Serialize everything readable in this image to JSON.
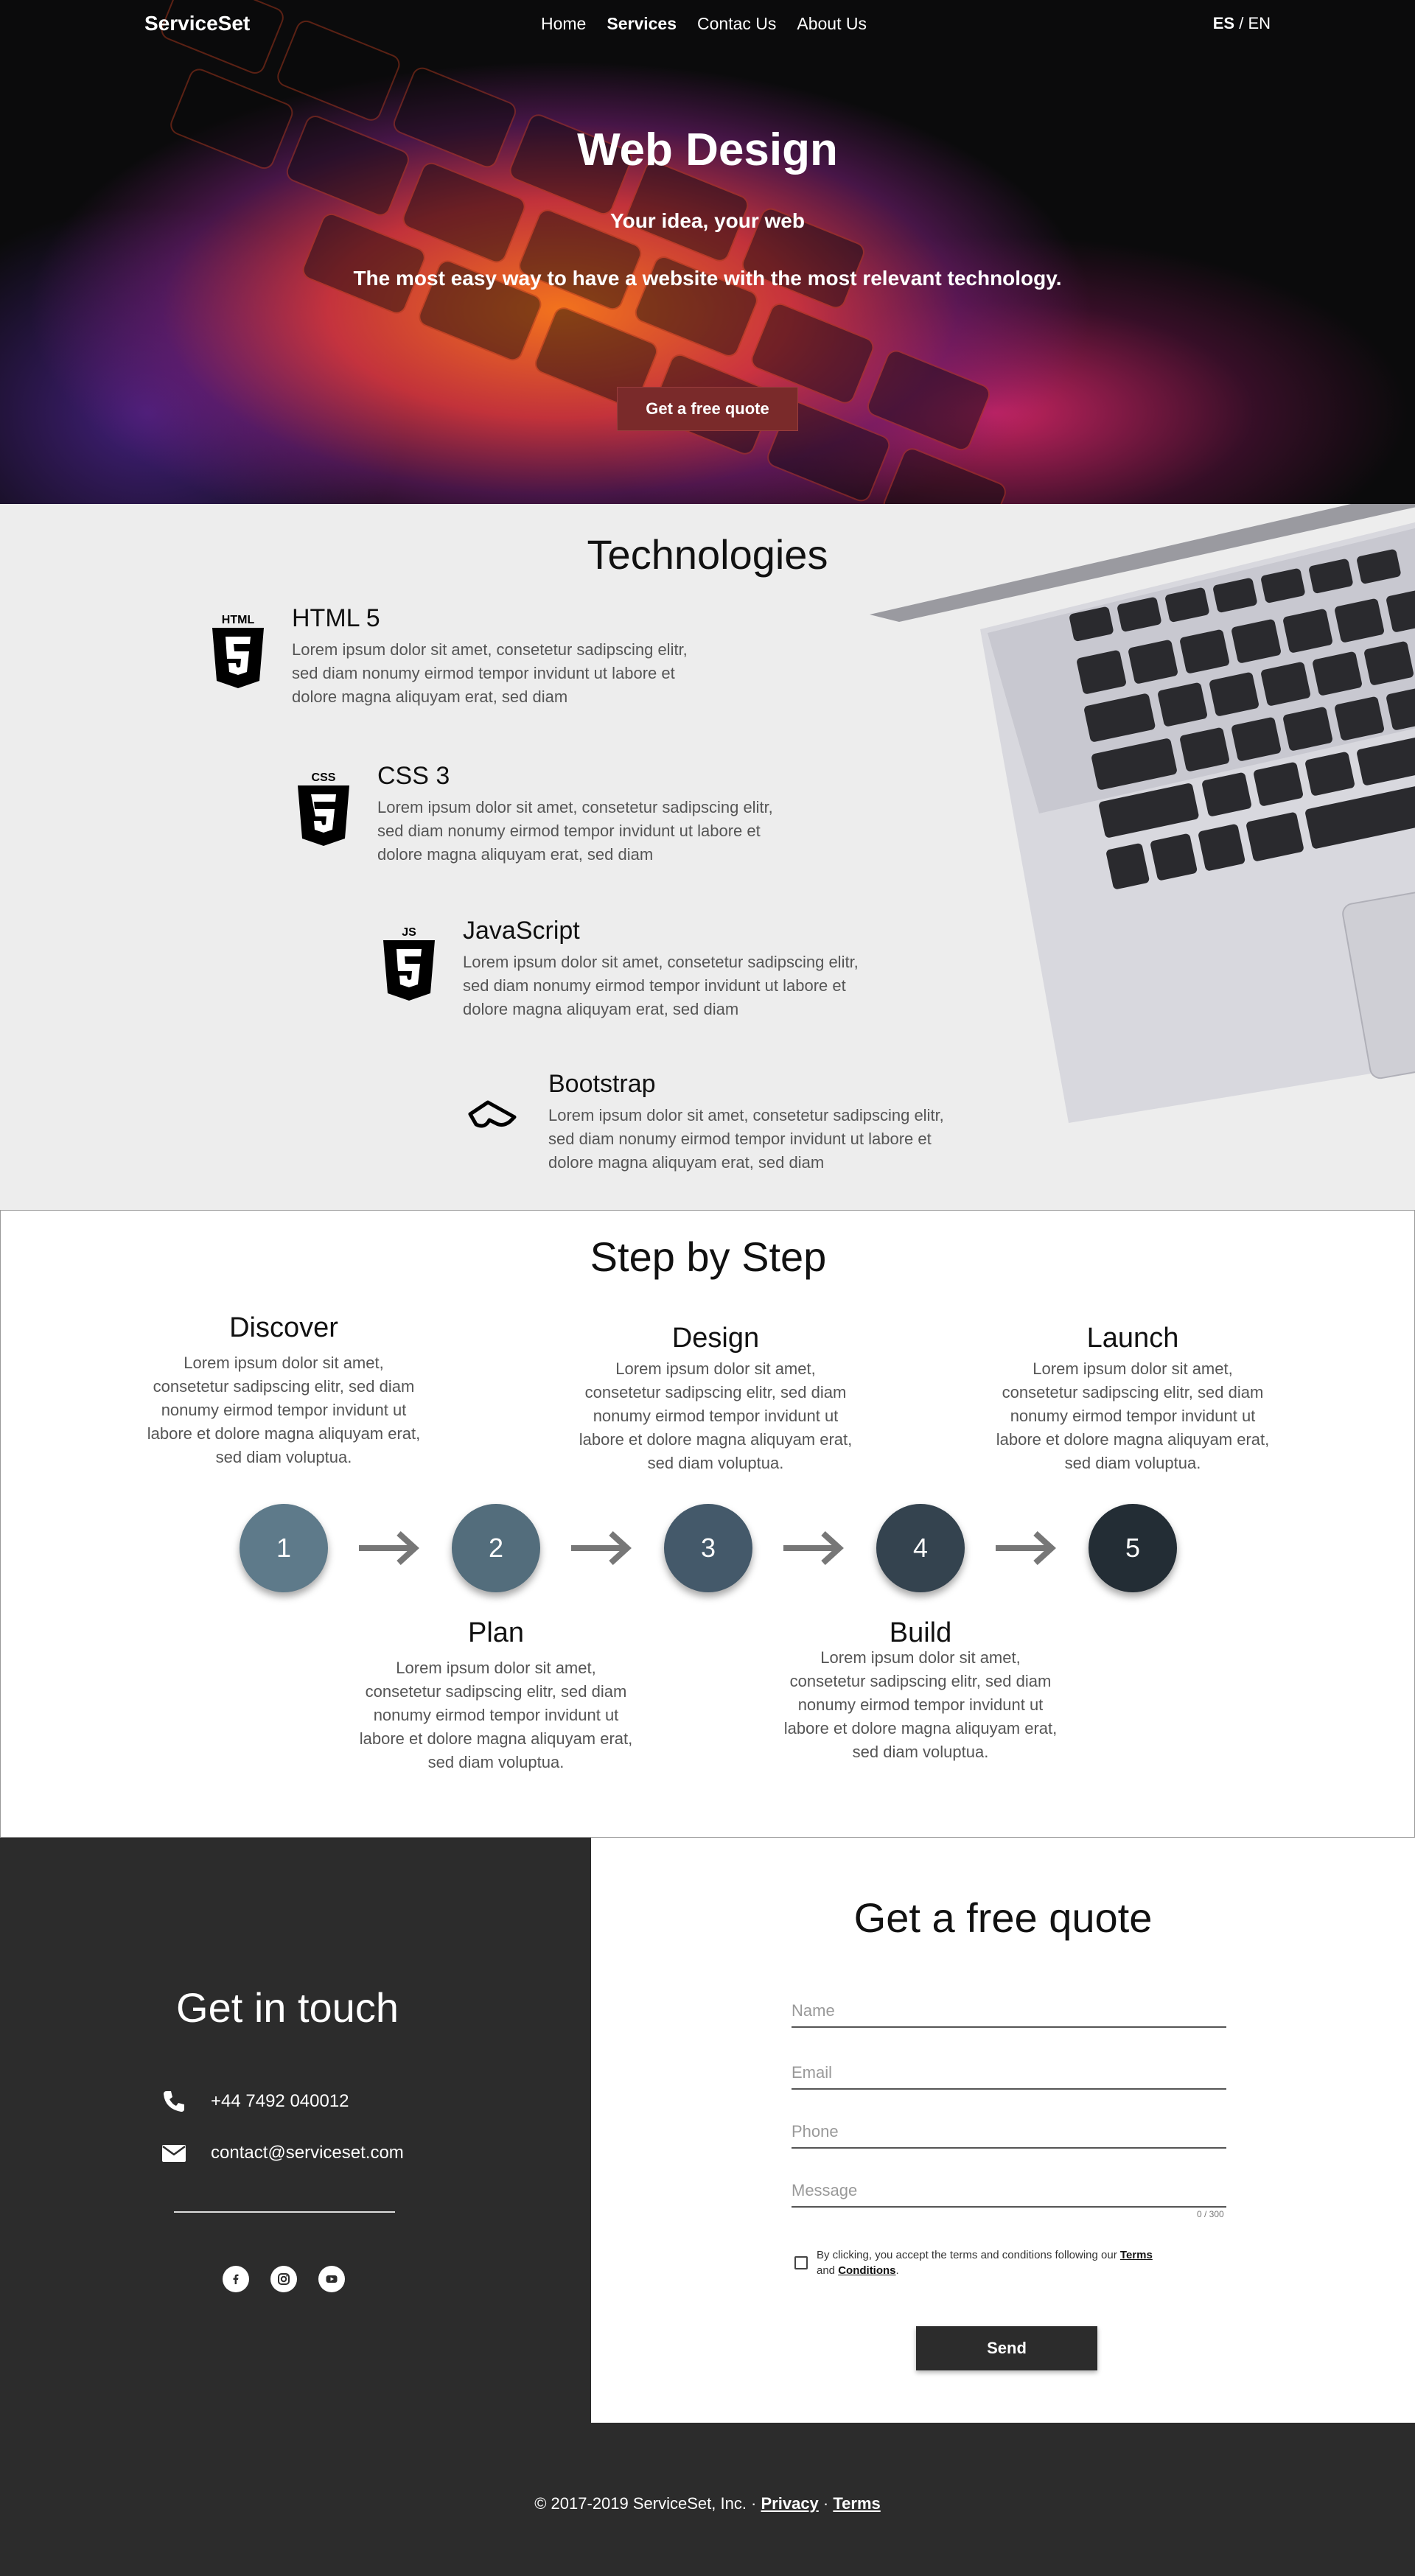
{
  "header": {
    "brand": "ServiceSet",
    "nav": [
      {
        "label": "Home",
        "active": false
      },
      {
        "label": "Services",
        "active": true
      },
      {
        "label": "Contac Us",
        "active": false
      },
      {
        "label": "About Us",
        "active": false
      }
    ],
    "lang_active": "ES",
    "lang_sep": " / ",
    "lang_other": "EN"
  },
  "hero": {
    "title": "Web Design",
    "subtitle": "Your idea, your web",
    "tagline": "The most easy way to have a website with the most relevant technology.",
    "cta": "Get a free quote"
  },
  "technologies": {
    "title": "Technologies",
    "items": [
      {
        "name": "HTML 5",
        "icon": "html5-icon",
        "desc": "Lorem ipsum dolor sit amet, consetetur sadipscing elitr, sed diam nonumy eirmod tempor invidunt ut labore et dolore magna aliquyam erat, sed diam"
      },
      {
        "name": "CSS 3",
        "icon": "css3-icon",
        "desc": "Lorem ipsum dolor sit amet, consetetur sadipscing elitr, sed diam nonumy eirmod tempor invidunt ut labore et dolore magna aliquyam erat, sed diam"
      },
      {
        "name": "JavaScript",
        "icon": "javascript-icon",
        "desc": "Lorem ipsum dolor sit amet, consetetur sadipscing elitr, sed diam nonumy eirmod tempor invidunt ut labore et dolore magna aliquyam erat, sed diam"
      },
      {
        "name": "Bootstrap",
        "icon": "bootstrap-icon",
        "desc": "Lorem ipsum dolor sit amet, consetetur sadipscing elitr, sed diam nonumy eirmod tempor invidunt ut labore et dolore magna aliquyam erat, sed diam"
      }
    ]
  },
  "steps": {
    "title": "Step by Step",
    "items": [
      {
        "number": "1",
        "name": "Discover",
        "desc": "Lorem ipsum dolor sit amet, consetetur sadipscing elitr, sed diam nonumy eirmod tempor invidunt ut labore et dolore magna aliquyam erat, sed diam voluptua.",
        "color": "#5e7a8a"
      },
      {
        "number": "2",
        "name": "Plan",
        "desc": "Lorem ipsum dolor sit amet, consetetur sadipscing elitr, sed diam nonumy eirmod tempor invidunt ut labore et dolore magna aliquyam erat, sed diam voluptua.",
        "color": "#536d7c"
      },
      {
        "number": "3",
        "name": "Design",
        "desc": "Lorem ipsum dolor sit amet, consetetur sadipscing elitr, sed diam nonumy eirmod tempor invidunt ut labore et dolore magna aliquyam erat, sed diam voluptua.",
        "color": "#44596a"
      },
      {
        "number": "4",
        "name": "Build",
        "desc": "Lorem ipsum dolor sit amet, consetetur sadipscing elitr, sed diam nonumy eirmod tempor invidunt ut labore et dolore magna aliquyam erat, sed diam voluptua.",
        "color": "#34434f"
      },
      {
        "number": "5",
        "name": "Launch",
        "desc": "Lorem ipsum dolor sit amet, consetetur sadipscing elitr, sed diam nonumy eirmod tempor invidunt ut labore et dolore magna aliquyam erat, sed diam voluptua.",
        "color": "#232d35"
      }
    ]
  },
  "contact": {
    "title": "Get in touch",
    "phone": "+44 7492 040012",
    "email": "contact@serviceset.com",
    "social": [
      "facebook-icon",
      "instagram-icon",
      "youtube-icon"
    ]
  },
  "quote": {
    "title": "Get a free quote",
    "fields": {
      "name": "Name",
      "email": "Email",
      "phone": "Phone",
      "message": "Message"
    },
    "counter": "0 / 300",
    "terms_prefix": "By clicking, you accept the terms and conditions following our ",
    "terms_link": "Terms",
    "terms_and": " and ",
    "conditions_link": "Conditions",
    "terms_suffix": ".",
    "send": "Send"
  },
  "footer": {
    "copyright": "© 2017-2019 ServiceSet, Inc. · ",
    "privacy": "Privacy",
    "sep": " · ",
    "terms": "Terms"
  },
  "colors": {
    "dark": "#2c2c2c",
    "cta": "#7a2a2a",
    "section_bg": "#ededed"
  }
}
